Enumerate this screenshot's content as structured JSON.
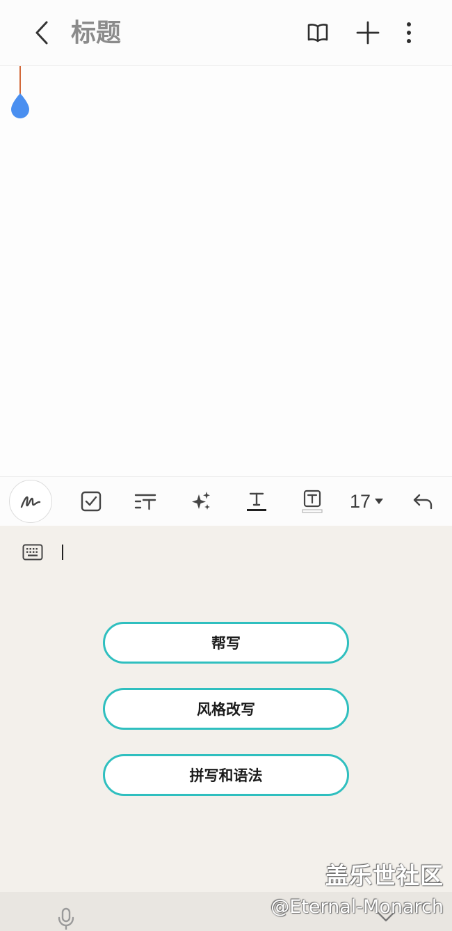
{
  "header": {
    "title": "标题",
    "back_icon": "chevron-left-icon",
    "read_icon": "book-open-icon",
    "add_icon": "plus-icon",
    "more_icon": "more-vertical-icon"
  },
  "toolbar": {
    "items": [
      {
        "icon": "handwriting-pen-icon"
      },
      {
        "icon": "checkbox-icon"
      },
      {
        "icon": "text-style-icon"
      },
      {
        "icon": "ai-sparkle-icon"
      },
      {
        "icon": "text-color-icon"
      },
      {
        "icon": "text-background-icon"
      },
      {
        "icon": "undo-icon"
      }
    ],
    "font_size": "17"
  },
  "ai_panel": {
    "buttons": [
      {
        "label": "帮写"
      },
      {
        "label": "风格改写"
      },
      {
        "label": "拼写和语法"
      }
    ],
    "accent_color": "#2fbfbf"
  },
  "watermark": {
    "site": "盖乐世社区",
    "author": "@Eternal-Monarch"
  },
  "colors": {
    "cursor_handle": "#4a8ff0",
    "cursor_line": "#d2693a",
    "panel_background": "#f3f0eb"
  }
}
